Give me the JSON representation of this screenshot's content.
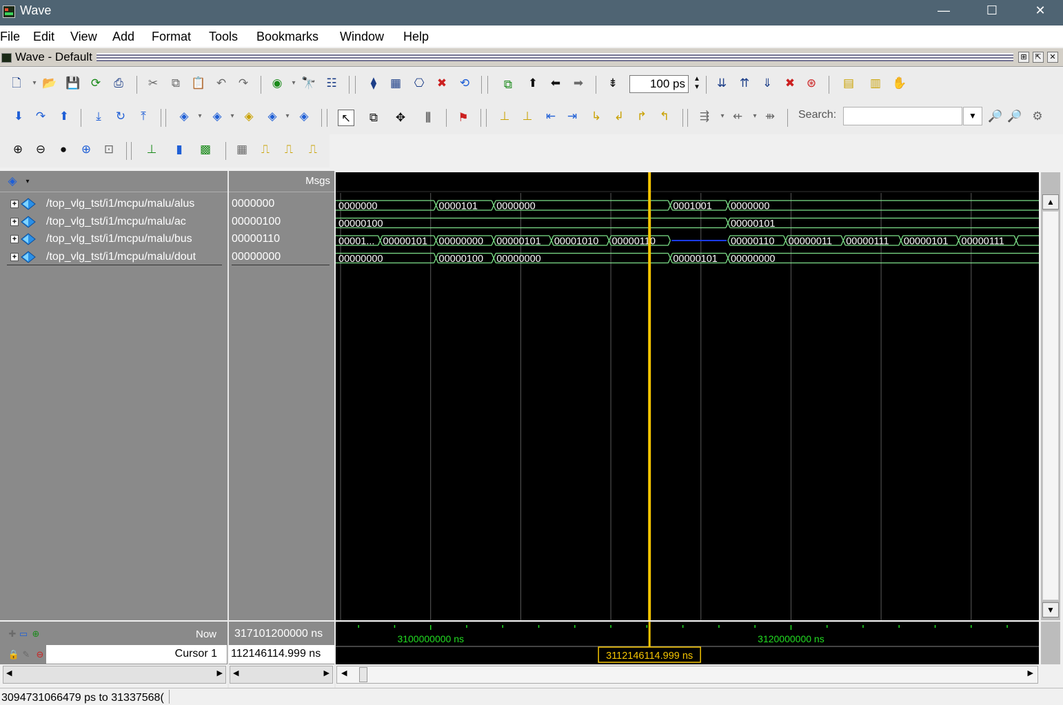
{
  "window": {
    "title": "Wave",
    "minimize": "—",
    "maximize": "☐",
    "close": "✕"
  },
  "menu": [
    "File",
    "Edit",
    "View",
    "Add",
    "Format",
    "Tools",
    "Bookmarks",
    "Window",
    "Help"
  ],
  "inner_window": {
    "title": "Wave - Default"
  },
  "toolbar": {
    "run_length": "100 ps",
    "search_label": "Search:",
    "search_value": ""
  },
  "panels": {
    "msgs_header": "Msgs"
  },
  "signals": [
    {
      "name": "/top_vlg_tst/i1/mcpu/malu/alus",
      "value": "0000000"
    },
    {
      "name": "/top_vlg_tst/i1/mcpu/malu/ac",
      "value": "00000100"
    },
    {
      "name": "/top_vlg_tst/i1/mcpu/malu/bus",
      "value": "00000110"
    },
    {
      "name": "/top_vlg_tst/i1/mcpu/malu/dout",
      "value": "00000000"
    }
  ],
  "waves": [
    {
      "segments": [
        {
          "start": 3094731066.479,
          "label": "0000000"
        },
        {
          "start": 3100300000,
          "label": "0000101"
        },
        {
          "start": 3103500000,
          "label": "0000000"
        },
        {
          "start": 3113300000,
          "label": "0001001"
        },
        {
          "start": 3116500000,
          "label": "0000000"
        }
      ]
    },
    {
      "segments": [
        {
          "start": 3094731066.479,
          "label": "00000100"
        },
        {
          "start": 3116500000,
          "label": "00000101"
        }
      ]
    },
    {
      "segments": [
        {
          "start": 3094731066.479,
          "label": "00001..."
        },
        {
          "start": 3097200000,
          "label": "00000101"
        },
        {
          "start": 3100300000,
          "label": "00000000"
        },
        {
          "start": 3103500000,
          "label": "00000101"
        },
        {
          "start": 3106700000,
          "label": "00001010"
        },
        {
          "start": 3109900000,
          "label": "00000110"
        },
        {
          "start": 3113300000,
          "label": "",
          "highz": true
        },
        {
          "start": 3116500000,
          "label": "00000110"
        },
        {
          "start": 3119700000,
          "label": "00000011"
        },
        {
          "start": 3122900000,
          "label": "00000111"
        },
        {
          "start": 3126100000,
          "label": "00000101"
        },
        {
          "start": 3129300000,
          "label": "00000111"
        },
        {
          "start": 3132500000,
          "label": ""
        }
      ]
    },
    {
      "segments": [
        {
          "start": 3094731066.479,
          "label": "00000000"
        },
        {
          "start": 3100300000,
          "label": "00000100"
        },
        {
          "start": 3103500000,
          "label": "00000000"
        },
        {
          "start": 3113300000,
          "label": "00000101"
        },
        {
          "start": 3116500000,
          "label": "00000000"
        }
      ]
    }
  ],
  "timeline": {
    "view_start_ps": 3094731066.479,
    "view_end_ps": 3133756800,
    "major_ticks": [
      3100000000,
      3120000000
    ],
    "major_tick_labels": [
      "3100000000 ns",
      "3120000000 ns"
    ],
    "minor_tick_step": 2000000,
    "grid_lines": [
      3095000000,
      3100000000,
      3105000000,
      3110000000,
      3115000000,
      3120000000,
      3125000000,
      3130000000
    ]
  },
  "cursor": {
    "position": 3112146114.999,
    "label": "3112146114.999 ns",
    "color": "#f5c400"
  },
  "bottom": {
    "now_label": "Now",
    "now_value": "317101200000 ns",
    "cursor_label": "Cursor 1",
    "cursor_value": "112146114.999 ns"
  },
  "status": {
    "text": "3094731066479 ps to 31337568("
  },
  "colors": {
    "wave_green": "#7ee28a",
    "wave_bg": "#000000",
    "highz": "#1a3bff",
    "grid": "#5a5a5a",
    "timeline_text": "#22dd22"
  }
}
